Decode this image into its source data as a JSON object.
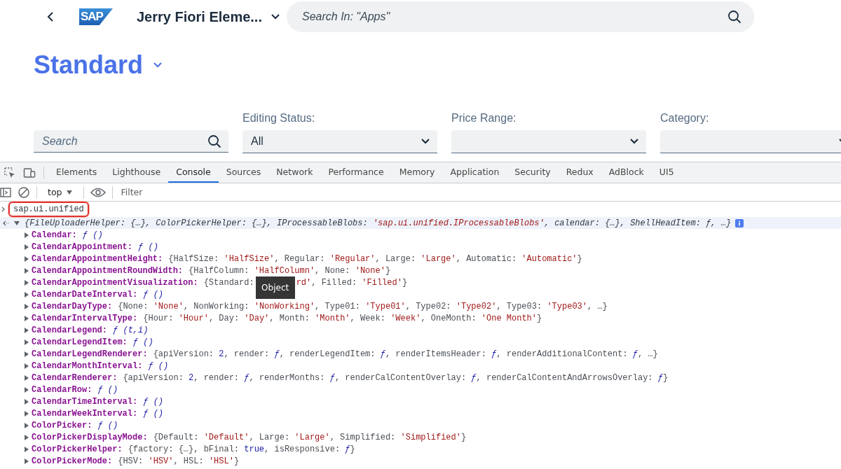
{
  "header": {
    "logo_text": "SAP",
    "app_title": "Jerry Fiori Eleme...",
    "search_placeholder": "Search In: \"Apps\""
  },
  "variant": {
    "title": "Standard"
  },
  "filters": [
    {
      "kind": "search",
      "placeholder": "Search"
    },
    {
      "kind": "select",
      "label": "Editing Status:",
      "value": "All"
    },
    {
      "kind": "select",
      "label": "Price Range:"
    },
    {
      "kind": "select",
      "label": "Category:"
    }
  ],
  "devtools": {
    "tabs": [
      {
        "label": "Elements",
        "selected": false
      },
      {
        "label": "Lighthouse",
        "selected": false
      },
      {
        "label": "Console",
        "selected": true
      },
      {
        "label": "Sources",
        "selected": false
      },
      {
        "label": "Network",
        "selected": false
      },
      {
        "label": "Performance",
        "selected": false
      },
      {
        "label": "Memory",
        "selected": false
      },
      {
        "label": "Application",
        "selected": false
      },
      {
        "label": "Security",
        "selected": false
      },
      {
        "label": "Redux",
        "selected": false
      },
      {
        "label": "AdBlock",
        "selected": false
      },
      {
        "label": "UI5",
        "selected": false
      }
    ],
    "context": "top",
    "filter_placeholder": "Filter",
    "input": {
      "text": "sap.ui.unified",
      "highlighted": true
    },
    "output": {
      "expanded": true,
      "summary": [
        {
          "kind": "plain",
          "text": "{FileUploaderHelper: {…}, ColorPickerHelper: {…}, IProcessableBlobs: "
        },
        {
          "kind": "string",
          "text": "'sap.ui.unified.IProcessableBlobs'"
        },
        {
          "kind": "plain",
          "text": ", calendar: {…}, ShellHeadItem: ƒ, …}"
        }
      ],
      "properties": [
        {
          "name": "Calendar:",
          "expanded": false,
          "value": [
            {
              "kind": "function",
              "text": "ƒ ()"
            }
          ]
        },
        {
          "name": "CalendarAppointment:",
          "expanded": false,
          "value": [
            {
              "kind": "function",
              "text": "ƒ ()"
            }
          ]
        },
        {
          "name": "CalendarAppointmentHeight:",
          "expanded": false,
          "value": [
            {
              "kind": "plain",
              "text": "{HalfSize: "
            },
            {
              "kind": "string",
              "text": "'HalfSize'"
            },
            {
              "kind": "plain",
              "text": ", Regular: "
            },
            {
              "kind": "string",
              "text": "'Regular'"
            },
            {
              "kind": "plain",
              "text": ", Large: "
            },
            {
              "kind": "string",
              "text": "'Large'"
            },
            {
              "kind": "plain",
              "text": ", Automatic: "
            },
            {
              "kind": "string",
              "text": "'Automatic'"
            },
            {
              "kind": "plain",
              "text": "}"
            }
          ]
        },
        {
          "name": "CalendarAppointmentRoundWidth:",
          "expanded": false,
          "value": [
            {
              "kind": "plain",
              "text": "{HalfColumn: "
            },
            {
              "kind": "string",
              "text": "'HalfColumn'"
            },
            {
              "kind": "plain",
              "text": ", None: "
            },
            {
              "kind": "string",
              "text": "'None'"
            },
            {
              "kind": "plain",
              "text": "}"
            }
          ]
        },
        {
          "name": "CalendarAppointmentVisualization:",
          "expanded": false,
          "value": [
            {
              "kind": "plain",
              "text": "{Standard:"
            },
            {
              "kind": "tooltip",
              "text": "Object"
            },
            {
              "kind": "string",
              "text": "rd'"
            },
            {
              "kind": "plain",
              "text": ", Filled: "
            },
            {
              "kind": "string",
              "text": "'Filled'"
            },
            {
              "kind": "plain",
              "text": "}"
            }
          ]
        },
        {
          "name": "CalendarDateInterval:",
          "expanded": false,
          "value": [
            {
              "kind": "function",
              "text": "ƒ ()"
            }
          ]
        },
        {
          "name": "CalendarDayType:",
          "expanded": false,
          "value": [
            {
              "kind": "plain",
              "text": "{None: "
            },
            {
              "kind": "string",
              "text": "'None'"
            },
            {
              "kind": "plain",
              "text": ", NonWorking: "
            },
            {
              "kind": "string",
              "text": "'NonWorking'"
            },
            {
              "kind": "plain",
              "text": ", Type01: "
            },
            {
              "kind": "string",
              "text": "'Type01'"
            },
            {
              "kind": "plain",
              "text": ", Type02: "
            },
            {
              "kind": "string",
              "text": "'Type02'"
            },
            {
              "kind": "plain",
              "text": ", Type03: "
            },
            {
              "kind": "string",
              "text": "'Type03'"
            },
            {
              "kind": "plain",
              "text": ", …}"
            }
          ]
        },
        {
          "name": "CalendarIntervalType:",
          "expanded": false,
          "value": [
            {
              "kind": "plain",
              "text": "{Hour: "
            },
            {
              "kind": "string",
              "text": "'Hour'"
            },
            {
              "kind": "plain",
              "text": ", Day: "
            },
            {
              "kind": "string",
              "text": "'Day'"
            },
            {
              "kind": "plain",
              "text": ", Month: "
            },
            {
              "kind": "string",
              "text": "'Month'"
            },
            {
              "kind": "plain",
              "text": ", Week: "
            },
            {
              "kind": "string",
              "text": "'Week'"
            },
            {
              "kind": "plain",
              "text": ", OneMonth: "
            },
            {
              "kind": "string",
              "text": "'One Month'"
            },
            {
              "kind": "plain",
              "text": "}"
            }
          ]
        },
        {
          "name": "CalendarLegend:",
          "expanded": false,
          "value": [
            {
              "kind": "function",
              "text": "ƒ (t,i)"
            }
          ]
        },
        {
          "name": "CalendarLegendItem:",
          "expanded": false,
          "value": [
            {
              "kind": "function",
              "text": "ƒ ()"
            }
          ]
        },
        {
          "name": "CalendarLegendRenderer:",
          "expanded": false,
          "value": [
            {
              "kind": "plain",
              "text": "{apiVersion: "
            },
            {
              "kind": "number",
              "text": "2"
            },
            {
              "kind": "plain",
              "text": ", render: "
            },
            {
              "kind": "function",
              "text": "ƒ"
            },
            {
              "kind": "plain",
              "text": ", renderLegendItem: "
            },
            {
              "kind": "function",
              "text": "ƒ"
            },
            {
              "kind": "plain",
              "text": ", renderItemsHeader: "
            },
            {
              "kind": "function",
              "text": "ƒ"
            },
            {
              "kind": "plain",
              "text": ", renderAdditionalContent: "
            },
            {
              "kind": "function",
              "text": "ƒ"
            },
            {
              "kind": "plain",
              "text": ", …}"
            }
          ]
        },
        {
          "name": "CalendarMonthInterval:",
          "expanded": false,
          "value": [
            {
              "kind": "function",
              "text": "ƒ ()"
            }
          ]
        },
        {
          "name": "CalendarRenderer:",
          "expanded": false,
          "value": [
            {
              "kind": "plain",
              "text": "{apiVersion: "
            },
            {
              "kind": "number",
              "text": "2"
            },
            {
              "kind": "plain",
              "text": ", render: "
            },
            {
              "kind": "function",
              "text": "ƒ"
            },
            {
              "kind": "plain",
              "text": ", renderMonths: "
            },
            {
              "kind": "function",
              "text": "ƒ"
            },
            {
              "kind": "plain",
              "text": ", renderCalContentOverlay: "
            },
            {
              "kind": "function",
              "text": "ƒ"
            },
            {
              "kind": "plain",
              "text": ", renderCalContentAndArrowsOverlay: "
            },
            {
              "kind": "function",
              "text": "ƒ"
            },
            {
              "kind": "plain",
              "text": "}"
            }
          ]
        },
        {
          "name": "CalendarRow:",
          "expanded": false,
          "value": [
            {
              "kind": "function",
              "text": "ƒ ()"
            }
          ]
        },
        {
          "name": "CalendarTimeInterval:",
          "expanded": false,
          "value": [
            {
              "kind": "function",
              "text": "ƒ ()"
            }
          ]
        },
        {
          "name": "CalendarWeekInterval:",
          "expanded": false,
          "value": [
            {
              "kind": "function",
              "text": "ƒ ()"
            }
          ]
        },
        {
          "name": "ColorPicker:",
          "expanded": false,
          "value": [
            {
              "kind": "function",
              "text": "ƒ ()"
            }
          ]
        },
        {
          "name": "ColorPickerDisplayMode:",
          "expanded": false,
          "value": [
            {
              "kind": "plain",
              "text": "{Default: "
            },
            {
              "kind": "string",
              "text": "'Default'"
            },
            {
              "kind": "plain",
              "text": ", Large: "
            },
            {
              "kind": "string",
              "text": "'Large'"
            },
            {
              "kind": "plain",
              "text": ", Simplified: "
            },
            {
              "kind": "string",
              "text": "'Simplified'"
            },
            {
              "kind": "plain",
              "text": "}"
            }
          ]
        },
        {
          "name": "ColorPickerHelper:",
          "expanded": false,
          "value": [
            {
              "kind": "plain",
              "text": "{factory: {…}, bFinal: "
            },
            {
              "kind": "number",
              "text": "true"
            },
            {
              "kind": "plain",
              "text": ", isResponsive: "
            },
            {
              "kind": "function",
              "text": "ƒ"
            },
            {
              "kind": "plain",
              "text": "}"
            }
          ]
        },
        {
          "name": "ColorPickerMode:",
          "expanded": false,
          "value": [
            {
              "kind": "plain",
              "text": "{HSV: "
            },
            {
              "kind": "string",
              "text": "'HSV'"
            },
            {
              "kind": "plain",
              "text": ", HSL: "
            },
            {
              "kind": "string",
              "text": "'HSL'"
            },
            {
              "kind": "plain",
              "text": "}"
            }
          ]
        }
      ]
    }
  }
}
